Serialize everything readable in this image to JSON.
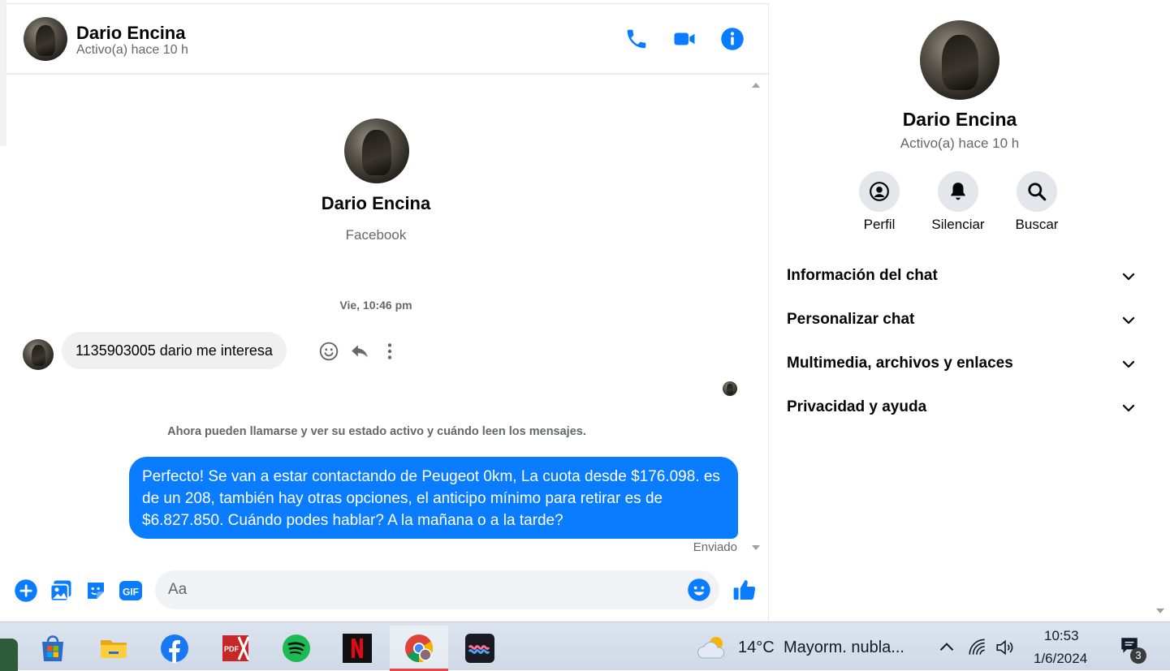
{
  "colors": {
    "accent": "#0a7cff",
    "bubble_in": "#f0f0f0",
    "muted": "#65676b"
  },
  "header": {
    "name": "Dario Encina",
    "status": "Activo(a) hace 10 h",
    "icons": [
      "phone-icon",
      "video-camera-icon",
      "info-icon"
    ]
  },
  "intro": {
    "name": "Dario Encina",
    "source": "Facebook"
  },
  "conversation": {
    "timestamp": "Vie, 10:46 pm",
    "incoming": "1135903005 dario me interesa",
    "system": "Ahora pueden llamarse y ver su estado activo y cuándo leen los mensajes.",
    "outgoing": "Perfecto!  Se van a estar contactando de Peugeot 0km, La cuota desde $176.098. es de un 208, también hay otras opciones, el anticipo mínimo para retirar es de $6.827.850. Cuándo podes hablar? A la mañana o a la tarde?",
    "status": "Enviado"
  },
  "composer": {
    "placeholder": "Aa",
    "gif_label": "GIF"
  },
  "panel": {
    "name": "Dario Encina",
    "status": "Activo(a) hace 10 h",
    "actions": [
      {
        "label": "Perfil",
        "icon": "profile-icon"
      },
      {
        "label": "Silenciar",
        "icon": "bell-icon"
      },
      {
        "label": "Buscar",
        "icon": "search-icon"
      }
    ],
    "sections": [
      "Información del chat",
      "Personalizar chat",
      "Multimedia, archivos y enlaces",
      "Privacidad y ayuda"
    ]
  },
  "taskbar": {
    "apps": [
      "microsoft-store",
      "file-explorer",
      "facebook",
      "pdf-viewer",
      "spotify",
      "netflix",
      "chrome",
      "wave-app"
    ],
    "pdf_label": "PDF",
    "weather_temp": "14°C",
    "weather_desc": "Mayorm. nubla...",
    "time": "10:53",
    "date": "1/6/2024",
    "notifications": "3"
  }
}
